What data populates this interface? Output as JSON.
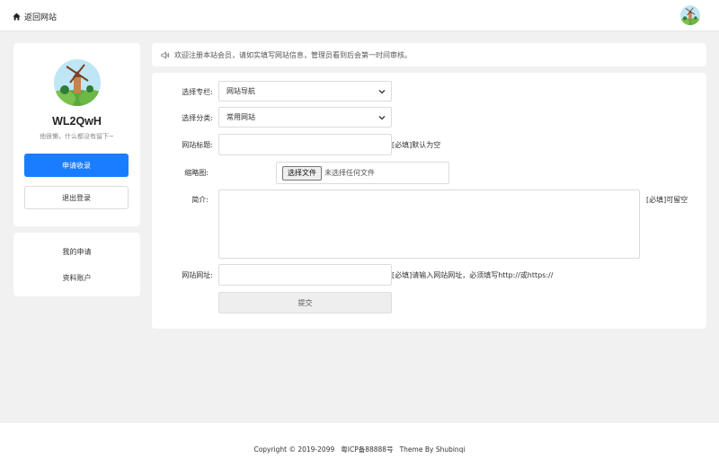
{
  "header": {
    "back_label": "返回网站",
    "back_icon": "home-icon",
    "avatar_icon": "avatar-windmill"
  },
  "profile": {
    "username": "WL2QwH",
    "bio": "他很懒，什么都没有留下~",
    "apply_label": "申请收录",
    "logout_label": "退出登录"
  },
  "nav": {
    "items": [
      {
        "label": "我的申请"
      },
      {
        "label": "资料账户"
      }
    ]
  },
  "notice": {
    "icon": "speaker-icon",
    "text": "欢迎注册本站会员，请如实填写网站信息，管理员看到后会第一时间审核。"
  },
  "form": {
    "column_label": "选择专栏:",
    "column_value": "网站导航",
    "category_label": "选择分类:",
    "category_value": "常用网站",
    "title_label": "网站标题:",
    "title_value": "",
    "title_hint": "[必填]默认为空",
    "thumb_label": "缩略图:",
    "file_button": "选择文件",
    "file_status": "未选择任何文件",
    "intro_label": "简介:",
    "intro_hint": "[必填]可留空",
    "url_label": "网站网址:",
    "url_value": "",
    "url_hint": "[必填]请输入网站网址，必须填写http://或https://",
    "submit_label": "提交"
  },
  "footer": {
    "copyright": "Copyright © 2019-2099",
    "icp": "粤ICP备88888号",
    "theme": "Theme By Shubinqi"
  },
  "colors": {
    "primary": "#1a7dff",
    "page_bg": "#f1f1f1",
    "card_bg": "#ffffff"
  }
}
